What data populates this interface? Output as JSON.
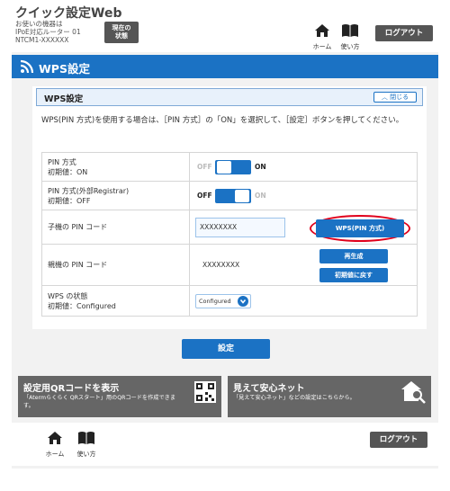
{
  "header": {
    "app_title": "クイック設定Web",
    "device_lines": [
      "お使いの機器は",
      "IPoE対応ルーター 01",
      "NTCM1-XXXXXX"
    ],
    "current_status_label": [
      "現在の",
      "状態"
    ],
    "home_label": "ホーム",
    "help_label": "使い方",
    "logout_label": "ログアウト"
  },
  "page_title": "WPS設定",
  "section": {
    "title": "WPS設定",
    "close_label": "閉じる",
    "description": "WPS(PIN 方式)を使用する場合は、［PIN 方式］の「ON」を選択して、［設定］ボタンを押してください。"
  },
  "rows": {
    "pin_method": {
      "label": "PIN 方式",
      "default": "初期値：ON",
      "off_label": "OFF",
      "on_label": "ON",
      "state": "on"
    },
    "pin_external": {
      "label": "PIN 方式(外部Registrar)",
      "default": "初期値：OFF",
      "off_label": "OFF",
      "on_label": "ON",
      "state": "off"
    },
    "child_pin": {
      "label": "子機の PIN コード",
      "value": "XXXXXXXX",
      "button_label": "WPS(PIN 方式)"
    },
    "parent_pin": {
      "label": "親機の PIN コード",
      "value": "XXXXXXXX",
      "regenerate_label": "再生成",
      "reset_label": "初期値に戻す"
    },
    "wps_state": {
      "label": "WPS の状態",
      "default": "初期値：Configured",
      "selected": "Configured"
    }
  },
  "submit_label": "設定",
  "promos": {
    "qr": {
      "title": "設定用QRコードを表示",
      "desc": "「Atermらくらく QRスタート」用のQRコードを作成できます。"
    },
    "mieru": {
      "title": "見えて安心ネット",
      "desc": "「見えて安心ネット」などの設定はこちらから。"
    }
  },
  "footer": {
    "home_label": "ホーム",
    "help_label": "使い方",
    "logout_label": "ログアウト"
  },
  "colors": {
    "accent": "#1b72c4",
    "highlight_ring": "#e0001b",
    "dark_button": "#555555"
  }
}
